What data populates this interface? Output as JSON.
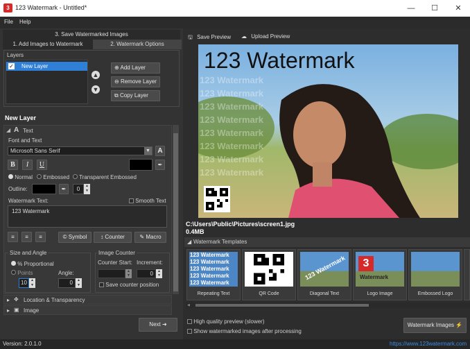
{
  "window": {
    "title": "123 Watermark - Untitled*",
    "app_icon": "3"
  },
  "menu": [
    "File",
    "Help"
  ],
  "steps": {
    "step3": "3. Save Watermarked Images",
    "step1": "1. Add Images to Watermark",
    "step2": "2. Watermark Options"
  },
  "layers": {
    "title": "Layers",
    "items": [
      {
        "label": "New Layer",
        "checked": true
      }
    ],
    "add": "Add Layer",
    "remove": "Remove Layer",
    "copy": "Copy Layer"
  },
  "layer_name": "New Layer",
  "text_section": {
    "title": "Text",
    "font_and_text": "Font and Text",
    "font": "Microsoft Sans Serif",
    "bold": "B",
    "italic": "I",
    "underline": "U",
    "style_options": [
      "Normal",
      "Embossed",
      "Transparent Embossed"
    ],
    "style_selected": "Normal",
    "outline_label": "Outline:",
    "outline_value": "0",
    "watermark_text_label": "Watermark Text:",
    "smooth_text": "Smooth Text",
    "watermark_text": "123 Watermark",
    "symbol": "Symbol",
    "counter": "Counter",
    "macro": "Macro"
  },
  "size_angle": {
    "title": "Size and Angle",
    "options": [
      "% Proportional",
      "Points"
    ],
    "selected": "% Proportional",
    "angle_label": "Angle:",
    "size_value": "10",
    "angle_value": "0"
  },
  "image_counter": {
    "title": "Image Counter",
    "counter_start_label": "Counter Start:",
    "increment_label": "Increment:",
    "counter_start_value": "",
    "increment_value": "0",
    "save_counter": "Save counter position"
  },
  "collapsed_sections": [
    "Location & Transparency",
    "Image"
  ],
  "next_button": "Next",
  "toolbar": {
    "save_preview": "Save Preview",
    "upload_preview": "Upload Preview"
  },
  "preview": {
    "watermark_text": "123 Watermark",
    "repeat_text": "123 Watermark",
    "file_path": "C:\\Users\\Public\\Pictures\\screen1.jpg",
    "file_size": "0.4MB"
  },
  "templates": {
    "title": "Watermark Templates",
    "items": [
      "Repeating Text",
      "QR Code",
      "Diagonal Text",
      "Logo Image",
      "Embossed Logo"
    ],
    "thumb_text": "123 Watermark",
    "logo_sub": "Watermark"
  },
  "options": {
    "high_quality": "High quality preview (slower)",
    "show_after": "Show watermarked images after processing"
  },
  "watermark_images_button": "Watermark Images",
  "status": {
    "version": "Version: 2.0.1.0",
    "website": "https://www.123watermark.com"
  },
  "colors": {
    "accent": "#2f7fd6",
    "link": "#3b8de0",
    "brand_red": "#d42a2a"
  }
}
